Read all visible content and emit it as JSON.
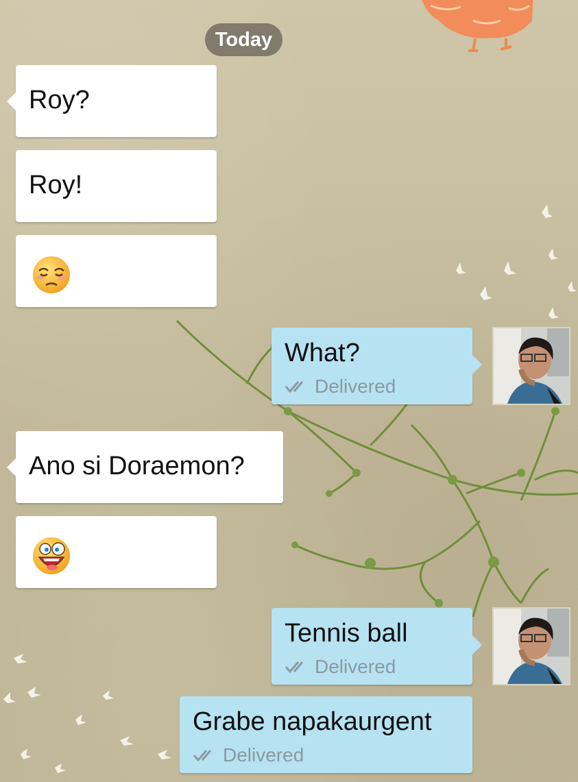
{
  "date_divider": "Today",
  "messages": [
    {
      "text": "Roy?"
    },
    {
      "text": "Roy!"
    },
    {
      "emoji": "sad-face-emoji"
    },
    {
      "text": "What?",
      "status": "Delivered"
    },
    {
      "text": "Ano si Doraemon?"
    },
    {
      "emoji": "laughing-face-emoji"
    },
    {
      "text": "Tennis ball",
      "status": "Delivered"
    },
    {
      "text": "Grabe napakaurgent",
      "status": "Delivered"
    }
  ],
  "colors": {
    "incoming_bubble": "#ffffff",
    "outgoing_bubble": "#b6e2f2",
    "date_pill": "#6e6a5e",
    "delivered_text": "#8a9aa1",
    "wallpaper": "#c6bc9f"
  },
  "icons": [
    "double-check-icon",
    "sad-face-emoji",
    "laughing-face-emoji",
    "owl-decoration",
    "branch-decoration",
    "bird-decoration"
  ]
}
